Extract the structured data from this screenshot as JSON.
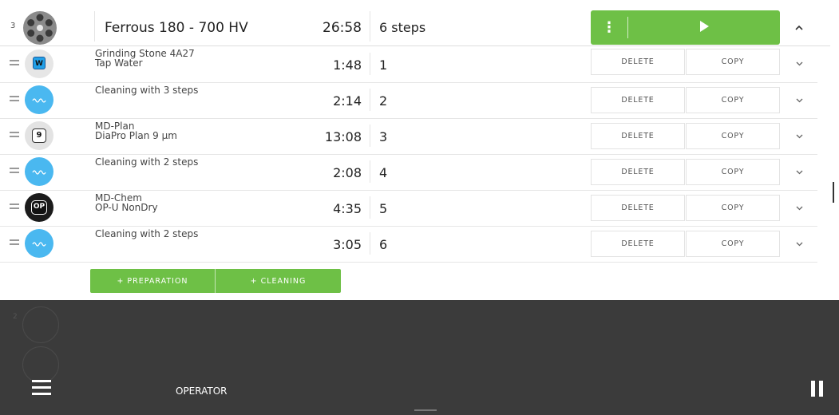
{
  "header": {
    "index": "3",
    "title": "Ferrous 180 - 700 HV",
    "time": "26:58",
    "steps": "6 steps",
    "run_menu_glyph": "⋮",
    "chevron": "^"
  },
  "steps": [
    {
      "line1": "Grinding Stone 4A27",
      "line2": "Tap Water",
      "time": "1:48",
      "num": "1",
      "icon": "water-icon",
      "icon_text": "W"
    },
    {
      "line1": "Cleaning with 3 steps",
      "line2": "",
      "time": "2:14",
      "num": "2",
      "icon": "cleaning-icon",
      "icon_text": ""
    },
    {
      "line1": "MD-Plan",
      "line2": "DiaPro Plan 9 μm",
      "time": "13:08",
      "num": "3",
      "icon": "nine-icon",
      "icon_text": "9"
    },
    {
      "line1": "Cleaning with 2 steps",
      "line2": "",
      "time": "2:08",
      "num": "4",
      "icon": "cleaning-icon",
      "icon_text": ""
    },
    {
      "line1": "MD-Chem",
      "line2": "OP-U NonDry",
      "time": "4:35",
      "num": "5",
      "icon": "op-icon",
      "icon_text": "OP"
    },
    {
      "line1": "Cleaning with 2 steps",
      "line2": "",
      "time": "3:05",
      "num": "6",
      "icon": "cleaning-icon",
      "icon_text": ""
    }
  ],
  "row_buttons": {
    "delete": "DELETE",
    "copy": "COPY",
    "chevron": "⌄"
  },
  "add": {
    "preparation": "+ PREPARATION",
    "cleaning": "+ CLEANING"
  },
  "bottom": {
    "ghost_index": "2",
    "operator": "OPERATOR"
  },
  "colors": {
    "accent_green": "#6ec046",
    "clean_blue": "#4ab8f0",
    "water_blue": "#22a0e8",
    "bottom_bar": "#3b3b3b"
  }
}
